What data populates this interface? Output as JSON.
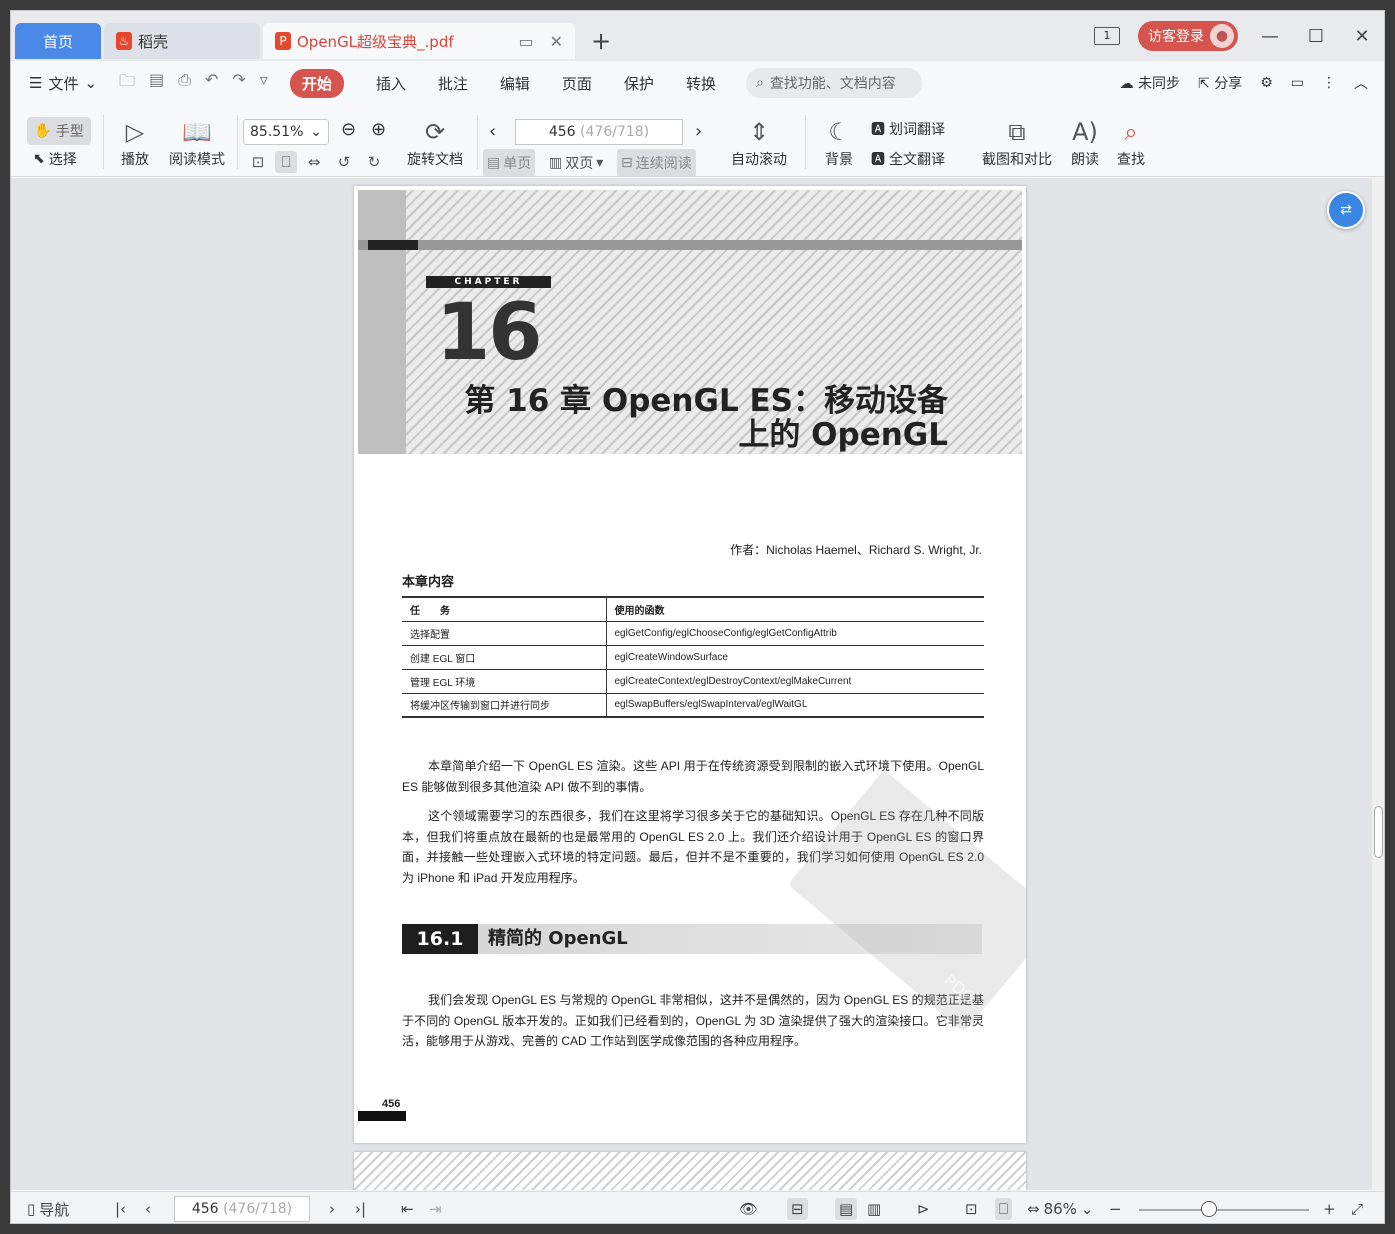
{
  "tabs": {
    "home": "首页",
    "daoke": "稻壳",
    "document": "OpenGL超级宝典_.pdf",
    "new_tab": "+"
  },
  "titlebar": {
    "layout_badge": "1",
    "login": "访客登录"
  },
  "menubar": {
    "file": "文件",
    "items": [
      "开始",
      "插入",
      "批注",
      "编辑",
      "页面",
      "保护",
      "转换"
    ],
    "search_placeholder": "查找功能、文档内容",
    "sync": "未同步",
    "share": "分享"
  },
  "toolbar": {
    "hand": "手型",
    "select": "选择",
    "play": "播放",
    "read_mode": "阅读模式",
    "zoom": "85.51%",
    "rotate": "旋转文档",
    "page_current": "456",
    "page_detail": "(476/718)",
    "single": "单页",
    "double": "双页",
    "continuous": "连续阅读",
    "auto_scroll": "自动滚动",
    "background": "背景",
    "word_translate": "划词翻译",
    "full_translate": "全文翻译",
    "screenshot_compare": "截图和对比",
    "read_aloud": "朗读",
    "find": "查找"
  },
  "document": {
    "chapter_label": "CHAPTER",
    "chapter_number": "16",
    "chapter_title_line1": "第 16 章  OpenGL ES：移动设备",
    "chapter_title_line2": "上的 OpenGL",
    "author": "作者：Nicholas Haemel、Richard S. Wright, Jr.",
    "contents_heading": "本章内容",
    "table_headers": [
      "任　　务",
      "使用的函数"
    ],
    "table_rows": [
      [
        "选择配置",
        "eglGetConfig/eglChooseConfig/eglGetConfigAttrib"
      ],
      [
        "创建 EGL 窗口",
        "eglCreateWindowSurface"
      ],
      [
        "管理 EGL 环境",
        "eglCreateContext/eglDestroyContext/eglMakeCurrent"
      ],
      [
        "将缓冲区传输到窗口并进行同步",
        "eglSwapBuffers/eglSwapInterval/eglWaitGL"
      ]
    ],
    "para1": "本章简单介绍一下 OpenGL ES 渲染。这些 API 用于在传统资源受到限制的嵌入式环境下使用。OpenGL ES 能够做到很多其他渲染 API 做不到的事情。",
    "para2": "这个领域需要学习的东西很多，我们在这里将学习很多关于它的基础知识。OpenGL ES 存在几种不同版本，但我们将重点放在最新的也是最常用的 OpenGL ES 2.0 上。我们还介绍设计用于 OpenGL ES 的窗口界面，并接触一些处理嵌入式环境的特定问题。最后，但并不是不重要的，我们学习如何使用 OpenGL ES 2.0 为 iPhone 和 iPad 开发应用程序。",
    "section_number": "16.1",
    "section_title": "精简的 OpenGL",
    "para3": "我们会发现 OpenGL ES 与常规的 OpenGL 非常相似，这并不是偶然的，因为 OpenGL ES 的规范正是基于不同的 OpenGL 版本开发的。正如我们已经看到的，OpenGL 为 3D 渲染提供了强大的渲染接口。它非常灵活，能够用于从游戏、完善的 CAD 工作站到医学成像范围的各种应用程序。",
    "watermark": "PDG",
    "page_number": "456"
  },
  "statusbar": {
    "nav": "导航",
    "page_current": "456",
    "page_detail": "(476/718)",
    "zoom": "86%"
  },
  "colors": {
    "accent_blue": "#4a89e8",
    "accent_red": "#d5544d"
  }
}
